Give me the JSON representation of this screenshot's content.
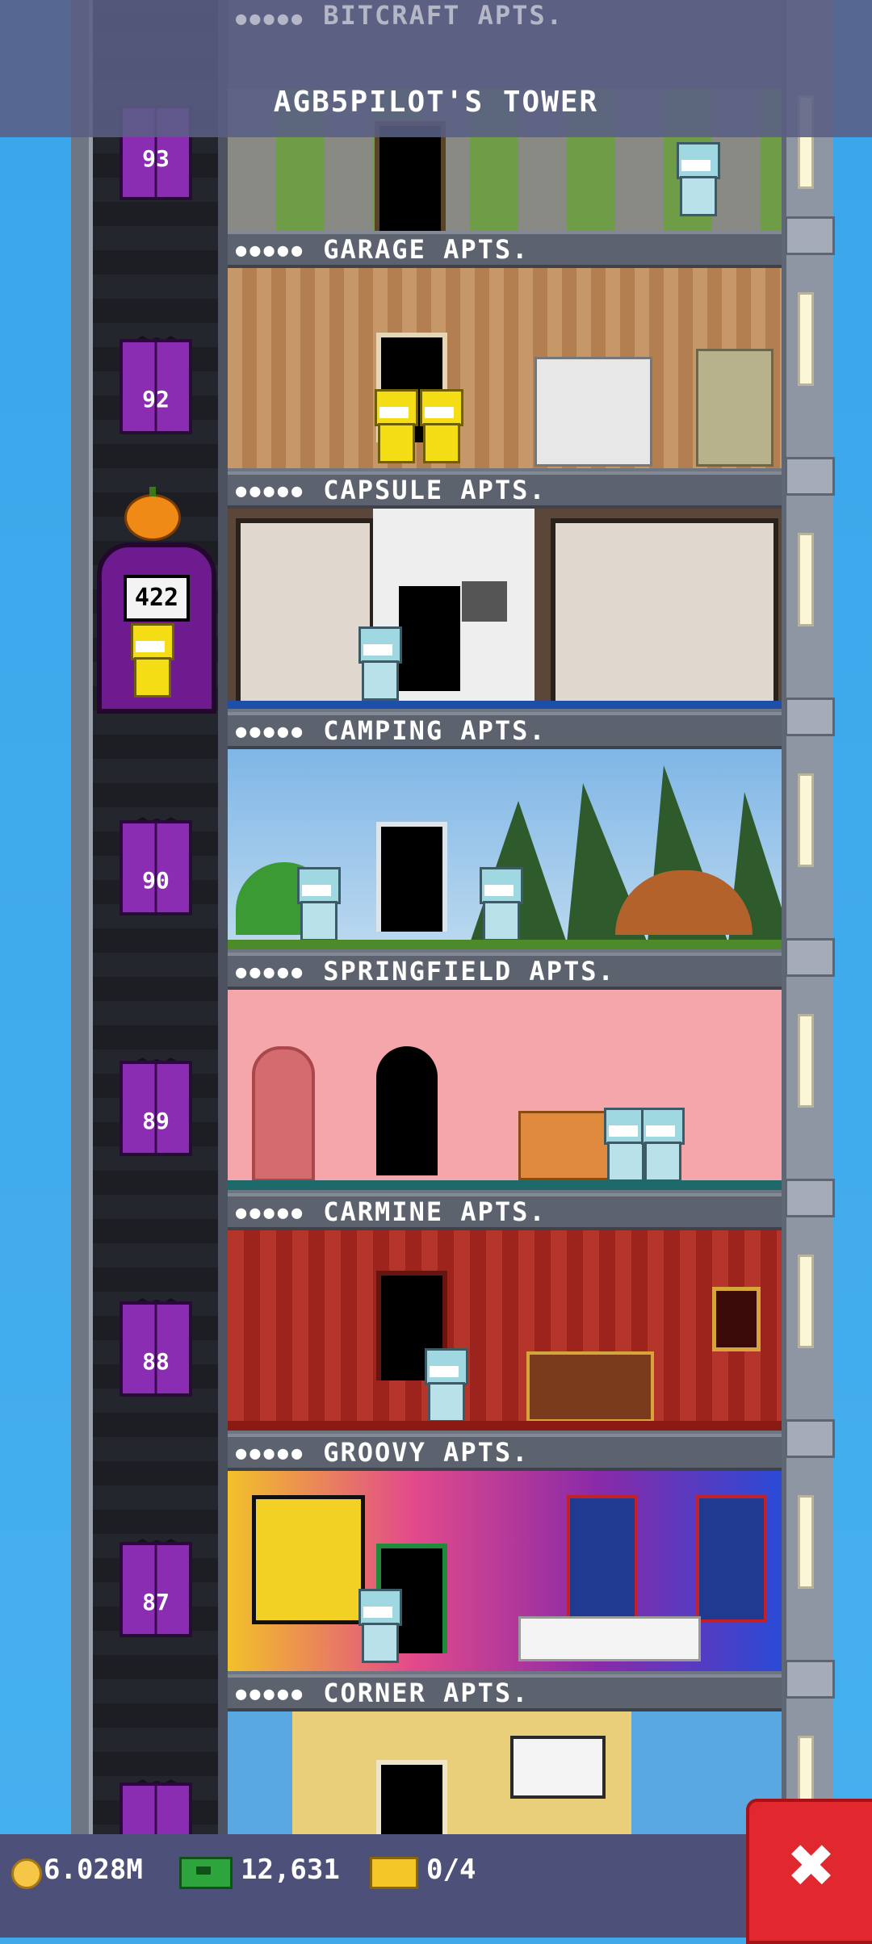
{
  "header": {
    "title": "AGB5PILOT'S TOWER",
    "faded_floor_label": "BITCRAFT APTS.",
    "faded_stars": "●●●●●"
  },
  "elevator": {
    "current_number": "422",
    "floor_numbers": [
      "93",
      "92",
      "90",
      "89",
      "88",
      "87"
    ]
  },
  "floors": [
    {
      "stars": "●●●●●",
      "name": "GARAGE APTS."
    },
    {
      "stars": "●●●●●",
      "name": "CAPSULE APTS."
    },
    {
      "stars": "●●●●●",
      "name": "CAMPING APTS."
    },
    {
      "stars": "●●●●●",
      "name": "SPRINGFIELD APTS."
    },
    {
      "stars": "●●●●●",
      "name": "CARMINE APTS."
    },
    {
      "stars": "●●●●●",
      "name": "GROOVY APTS."
    },
    {
      "stars": "●●●●●",
      "name": "CORNER APTS."
    }
  ],
  "status_bar": {
    "coins": "6.028M",
    "bux": "12,631",
    "tickets": "0/4"
  },
  "close_button": {
    "label": "✖"
  },
  "icons": {
    "coin": "coin-icon",
    "cash": "cash-icon",
    "ticket": "ticket-icon",
    "pumpkin": "pumpkin-icon"
  }
}
